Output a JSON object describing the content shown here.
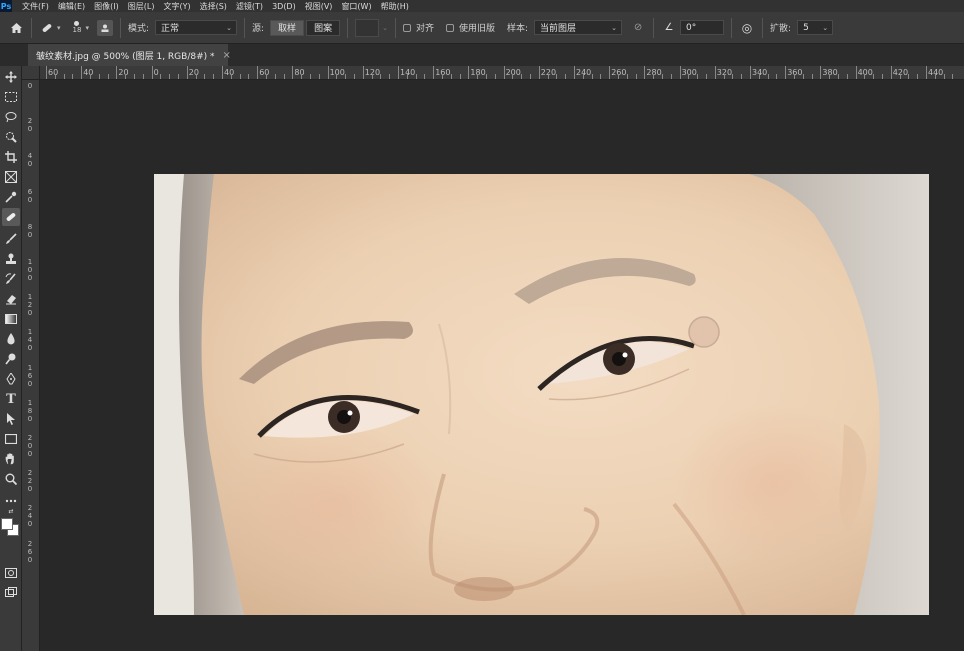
{
  "menubar": {
    "logo": "Ps",
    "items": [
      "文件(F)",
      "编辑(E)",
      "图像(I)",
      "图层(L)",
      "文字(Y)",
      "选择(S)",
      "滤镜(T)",
      "3D(D)",
      "视图(V)",
      "窗口(W)",
      "帮助(H)"
    ]
  },
  "options": {
    "brush_size": "18",
    "mode_label": "模式:",
    "mode_value": "正常",
    "source_label": "源:",
    "source_sample": "取样",
    "source_pattern": "图案",
    "aligned_label": "对齐",
    "legacy_label": "使用旧版",
    "sample_label": "样本:",
    "sample_value": "当前图层",
    "angle_value": "0°",
    "diffusion_label": "扩散:",
    "diffusion_value": "5"
  },
  "tab": {
    "title": "皱纹素材.jpg @ 500% (图层 1, RGB/8#) *",
    "close": "×"
  },
  "hruler": {
    "labels": [
      "60",
      "40",
      "20",
      "0",
      "20",
      "40",
      "60",
      "80",
      "100",
      "120",
      "140",
      "160",
      "180",
      "200",
      "220",
      "240",
      "260",
      "280",
      "300",
      "320",
      "340",
      "360",
      "380",
      "400",
      "420",
      "440"
    ]
  },
  "vruler": {
    "labels": [
      "0",
      "20",
      "40",
      "60",
      "80",
      "100",
      "120",
      "140",
      "160",
      "180",
      "200",
      "220",
      "240",
      "260"
    ]
  },
  "colors": {
    "foreground": "#ffffff",
    "background": "#ffffff",
    "accent": "#31a8ff"
  },
  "toolbar": {
    "icons": [
      "move-icon",
      "marquee-icon",
      "lasso-icon",
      "quick-select-icon",
      "crop-icon",
      "frame-icon",
      "eyedropper-icon",
      "healing-brush-icon",
      "brush-icon",
      "clone-stamp-icon",
      "history-brush-icon",
      "eraser-icon",
      "gradient-icon",
      "blur-icon",
      "dodge-icon",
      "pen-icon",
      "type-icon",
      "path-select-icon",
      "rectangle-icon",
      "hand-icon",
      "zoom-icon",
      "more-tools-icon",
      "quick-mask-icon",
      "screen-mode-icon"
    ]
  }
}
